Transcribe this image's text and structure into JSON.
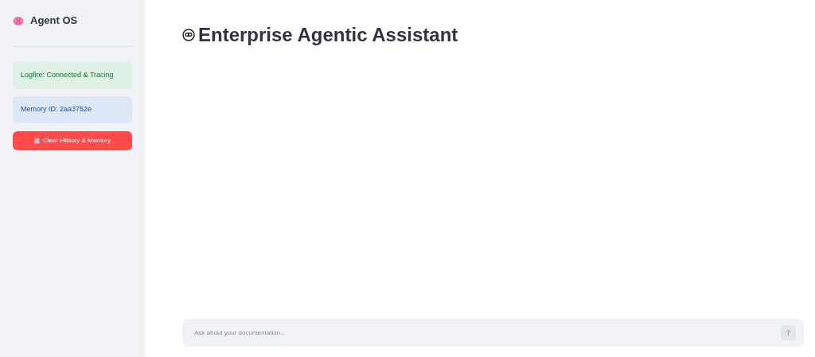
{
  "sidebar": {
    "title": "Agent OS",
    "alerts": [
      {
        "kind": "success",
        "text": "Logfire: Connected & Tracing"
      },
      {
        "kind": "info",
        "text": "Memory ID: 2aa3752e"
      }
    ],
    "button": "Clear History & Memory"
  },
  "main": {
    "title": "Enterprise Agentic Assistant"
  },
  "chat_input": {
    "placeholder": "Ask about your documentation..."
  }
}
